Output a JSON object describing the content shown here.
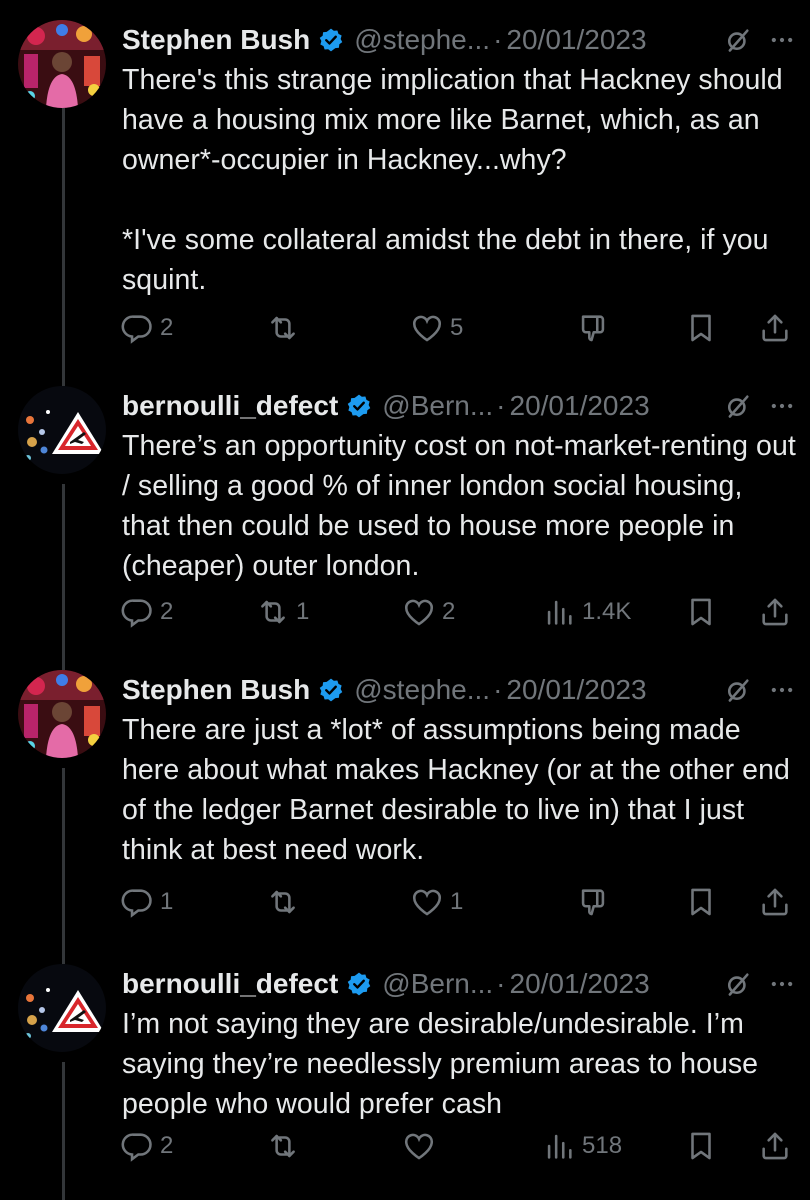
{
  "tweets": [
    {
      "author": "Stephen Bush",
      "handle": "@stephe...",
      "date": "20/01/2023",
      "text": "There's this strange implication that Hackney should have a housing mix more like Barnet, which, as an owner*-occupier in Hackney...why?\n\n*I've some collateral amidst the debt in there, if you squint.",
      "replies": "2",
      "reposts": "",
      "likes": "5",
      "views": ""
    },
    {
      "author": "bernoulli_defect",
      "handle": "@Bern...",
      "date": "20/01/2023",
      "text": "There’s an opportunity cost on not-market-renting out / selling a good % of inner london social housing, that then could be used to house more people in (cheaper) outer london.",
      "replies": "2",
      "reposts": "1",
      "likes": "2",
      "views": "1.4K"
    },
    {
      "author": "Stephen Bush",
      "handle": "@stephe...",
      "date": "20/01/2023",
      "text": "There are just a *lot* of assumptions being made here about what makes Hackney (or at the other end of the ledger Barnet desirable to live in) that I just think at best need work.",
      "replies": "1",
      "reposts": "",
      "likes": "1",
      "views": ""
    },
    {
      "author": "bernoulli_defect",
      "handle": "@Bern...",
      "date": "20/01/2023",
      "text": "I’m not saying they are desirable/undesirable. I’m saying they’re needlessly premium areas to house people who would prefer cash",
      "replies": "2",
      "reposts": "",
      "likes": "",
      "views": "518"
    }
  ],
  "colors": {
    "background": "#000000",
    "text": "#e7e9ea",
    "muted": "#71767b",
    "verified": "#1d9bf0",
    "thread_line": "#333639"
  },
  "icons": [
    "reply-icon",
    "repost-icon",
    "like-icon",
    "views-icon",
    "downvote-icon",
    "bookmark-icon",
    "share-icon",
    "grok-icon",
    "more-icon",
    "verified-icon"
  ]
}
